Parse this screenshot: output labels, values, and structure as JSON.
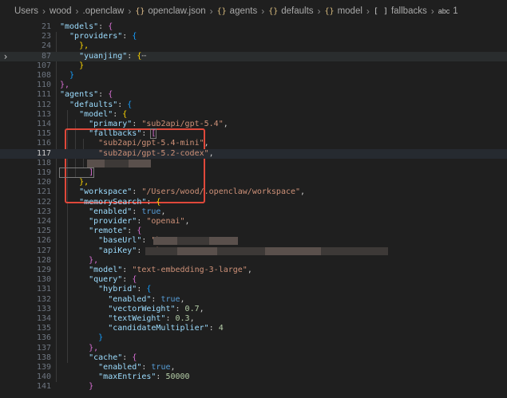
{
  "breadcrumb": {
    "items": [
      "Users",
      "wood",
      ".openclaw",
      "openclaw.json",
      "agents",
      "defaults",
      "model",
      "fallbacks",
      "1"
    ],
    "icons": [
      "",
      "",
      "",
      "json-icon",
      "object-icon",
      "object-icon",
      "object-icon",
      "array-icon",
      "string-icon"
    ],
    "icon_glyphs": [
      "",
      "",
      "",
      "{}",
      "{}",
      "{}",
      "{}",
      "[ ]",
      "abc"
    ]
  },
  "lines": [
    {
      "n": "21",
      "code": [
        [
          "k",
          "\"models\""
        ],
        [
          "p",
          ": "
        ],
        [
          "b2",
          "{"
        ]
      ]
    },
    {
      "n": "23",
      "code": [
        [
          "k",
          "  \"providers\""
        ],
        [
          "p",
          ": "
        ],
        [
          "b3",
          "{"
        ]
      ]
    },
    {
      "n": "24",
      "code": [
        [
          "b1",
          "    },"
        ]
      ]
    },
    {
      "n": "87",
      "code": [
        [
          "k",
          "    \"yuanjing\""
        ],
        [
          "p",
          ": "
        ],
        [
          "b1",
          "{"
        ],
        [
          "ell",
          "⋯"
        ]
      ],
      "fold": true,
      "highlight": true
    },
    {
      "n": "107",
      "code": [
        [
          "b1",
          "    }"
        ]
      ]
    },
    {
      "n": "108",
      "code": [
        [
          "b3",
          "  }"
        ]
      ]
    },
    {
      "n": "110",
      "code": [
        [
          "b2",
          "},"
        ]
      ]
    },
    {
      "n": "111",
      "code": [
        [
          "k",
          "\"agents\""
        ],
        [
          "p",
          ": "
        ],
        [
          "b2",
          "{"
        ]
      ]
    },
    {
      "n": "112",
      "code": [
        [
          "k",
          "  \"defaults\""
        ],
        [
          "p",
          ": "
        ],
        [
          "b3",
          "{"
        ]
      ]
    },
    {
      "n": "113",
      "code": [
        [
          "k",
          "    \"model\""
        ],
        [
          "p",
          ": "
        ],
        [
          "b1",
          "{"
        ]
      ]
    },
    {
      "n": "114",
      "code": [
        [
          "k",
          "      \"primary\""
        ],
        [
          "p",
          ": "
        ],
        [
          "s",
          "\"sub2api/gpt-5.4\""
        ],
        [
          "p",
          ","
        ]
      ]
    },
    {
      "n": "115",
      "code": [
        [
          "k",
          "      \"fallbacks\""
        ],
        [
          "p",
          ": "
        ],
        [
          "b2",
          "["
        ]
      ]
    },
    {
      "n": "116",
      "code": [
        [
          "s",
          "        \"sub2api/gpt-5.4-mini\""
        ],
        [
          "p",
          ","
        ]
      ]
    },
    {
      "n": "117",
      "code": [
        [
          "s",
          "        \"sub2api/gpt-5.2-codex\""
        ],
        [
          "p",
          ","
        ]
      ],
      "current": true
    },
    {
      "n": "118",
      "code": []
    },
    {
      "n": "119",
      "code": [
        [
          "b2",
          "      ]"
        ]
      ]
    },
    {
      "n": "120",
      "code": [
        [
          "b1",
          "    },"
        ]
      ]
    },
    {
      "n": "121",
      "code": [
        [
          "k",
          "    \"workspace\""
        ],
        [
          "p",
          ": "
        ],
        [
          "s",
          "\"/Users/wood/.openclaw/workspace\""
        ],
        [
          "p",
          ","
        ]
      ]
    },
    {
      "n": "122",
      "code": [
        [
          "k",
          "    \"memorySearch\""
        ],
        [
          "p",
          ": "
        ],
        [
          "b1",
          "{"
        ]
      ]
    },
    {
      "n": "123",
      "code": [
        [
          "k",
          "      \"enabled\""
        ],
        [
          "p",
          ": "
        ],
        [
          "kw",
          "true"
        ],
        [
          "p",
          ","
        ]
      ]
    },
    {
      "n": "124",
      "code": [
        [
          "k",
          "      \"provider\""
        ],
        [
          "p",
          ": "
        ],
        [
          "s",
          "\"openai\""
        ],
        [
          "p",
          ","
        ]
      ]
    },
    {
      "n": "125",
      "code": [
        [
          "k",
          "      \"remote\""
        ],
        [
          "p",
          ": "
        ],
        [
          "b2",
          "{"
        ]
      ]
    },
    {
      "n": "126",
      "code": [
        [
          "k",
          "        \"baseUrl\""
        ],
        [
          "p",
          ": "
        ],
        [
          "s",
          "\"ht"
        ]
      ]
    },
    {
      "n": "127",
      "code": [
        [
          "k",
          "        \"apiKey\""
        ],
        [
          "p",
          ": "
        ],
        [
          "s",
          "\"sk-"
        ]
      ]
    },
    {
      "n": "128",
      "code": [
        [
          "b2",
          "      },"
        ]
      ]
    },
    {
      "n": "129",
      "code": [
        [
          "k",
          "      \"model\""
        ],
        [
          "p",
          ": "
        ],
        [
          "s",
          "\"text-embedding-3-large\""
        ],
        [
          "p",
          ","
        ]
      ]
    },
    {
      "n": "130",
      "code": [
        [
          "k",
          "      \"query\""
        ],
        [
          "p",
          ": "
        ],
        [
          "b2",
          "{"
        ]
      ]
    },
    {
      "n": "131",
      "code": [
        [
          "k",
          "        \"hybrid\""
        ],
        [
          "p",
          ": "
        ],
        [
          "b3",
          "{"
        ]
      ]
    },
    {
      "n": "132",
      "code": [
        [
          "k",
          "          \"enabled\""
        ],
        [
          "p",
          ": "
        ],
        [
          "kw",
          "true"
        ],
        [
          "p",
          ","
        ]
      ]
    },
    {
      "n": "133",
      "code": [
        [
          "k",
          "          \"vectorWeight\""
        ],
        [
          "p",
          ": "
        ],
        [
          "n",
          "0.7"
        ],
        [
          "p",
          ","
        ]
      ]
    },
    {
      "n": "134",
      "code": [
        [
          "k",
          "          \"textWeight\""
        ],
        [
          "p",
          ": "
        ],
        [
          "n",
          "0.3"
        ],
        [
          "p",
          ","
        ]
      ]
    },
    {
      "n": "135",
      "code": [
        [
          "k",
          "          \"candidateMultiplier\""
        ],
        [
          "p",
          ": "
        ],
        [
          "n",
          "4"
        ]
      ]
    },
    {
      "n": "136",
      "code": [
        [
          "b3",
          "        }"
        ]
      ]
    },
    {
      "n": "137",
      "code": [
        [
          "b2",
          "      },"
        ]
      ]
    },
    {
      "n": "138",
      "code": [
        [
          "k",
          "      \"cache\""
        ],
        [
          "p",
          ": "
        ],
        [
          "b2",
          "{"
        ]
      ]
    },
    {
      "n": "139",
      "code": [
        [
          "k",
          "        \"enabled\""
        ],
        [
          "p",
          ": "
        ],
        [
          "kw",
          "true"
        ],
        [
          "p",
          ","
        ]
      ]
    },
    {
      "n": "140",
      "code": [
        [
          "k",
          "        \"maxEntries\""
        ],
        [
          "p",
          ": "
        ],
        [
          "n",
          "50000"
        ]
      ]
    },
    {
      "n": "141",
      "code": [
        [
          "b2",
          "      }"
        ]
      ]
    }
  ],
  "colors": {
    "background": "#1f1f1f",
    "annotation_box": "#e0483a",
    "string": "#ce9178",
    "key": "#9cdcfe",
    "number": "#b5cea8",
    "keyword": "#569cd6"
  }
}
